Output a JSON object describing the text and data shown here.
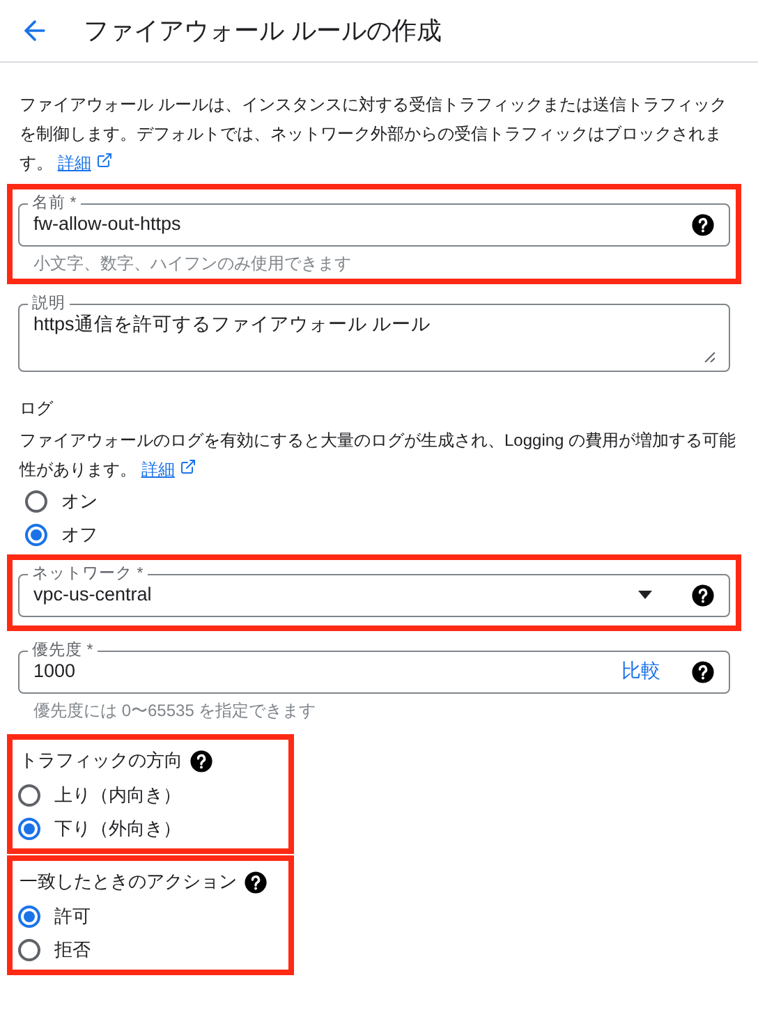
{
  "header": {
    "title": "ファイアウォール ルールの作成"
  },
  "intro": {
    "text": "ファイアウォール ルールは、インスタンスに対する受信トラフィックまたは送信トラフィックを制御します。デフォルトでは、ネットワーク外部からの受信トラフィックはブロックされます。",
    "link": "詳細"
  },
  "name_field": {
    "label": "名前 *",
    "value": "fw-allow-out-https",
    "hint": "小文字、数字、ハイフンのみ使用できます",
    "highlighted": true
  },
  "description_field": {
    "label": "説明",
    "value": "https通信を許可するファイアウォール ルール",
    "highlighted": false
  },
  "logs": {
    "title": "ログ",
    "text": "ファイアウォールのログを有効にすると大量のログが生成され、Logging の費用が増加する可能性があります。",
    "link": "詳細",
    "options": [
      {
        "label": "オン",
        "selected": false
      },
      {
        "label": "オフ",
        "selected": true
      }
    ]
  },
  "network_field": {
    "label": "ネットワーク *",
    "value": "vpc-us-central",
    "highlighted": true
  },
  "priority_field": {
    "label": "優先度 *",
    "value": "1000",
    "action": "比較",
    "hint": "優先度には 0〜65535 を指定できます",
    "highlighted": false
  },
  "direction": {
    "title": "トラフィックの方向",
    "highlighted": true,
    "options": [
      {
        "label": "上り（内向き）",
        "selected": false
      },
      {
        "label": "下り（外向き）",
        "selected": true
      }
    ]
  },
  "match_action": {
    "title": "一致したときのアクション",
    "highlighted": true,
    "options": [
      {
        "label": "許可",
        "selected": true
      },
      {
        "label": "拒否",
        "selected": false
      }
    ]
  }
}
